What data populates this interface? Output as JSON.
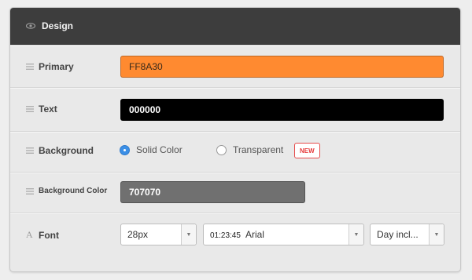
{
  "header": {
    "title": "Design",
    "icon": "eye-icon"
  },
  "primary": {
    "label": "Primary",
    "value": "FF8A30",
    "color": "#ff8a30"
  },
  "text": {
    "label": "Text",
    "value": "000000",
    "color": "#000000"
  },
  "background": {
    "label": "Background",
    "options": [
      {
        "label": "Solid Color",
        "selected": true
      },
      {
        "label": "Transparent",
        "selected": false
      }
    ],
    "badge": "NEW"
  },
  "background_color": {
    "label": "Background Color",
    "value": "707070",
    "color": "#707070"
  },
  "font": {
    "label": "Font",
    "icon_glyph": "A",
    "size": "28px",
    "time": "01:23:45",
    "family": "Arial",
    "day_option": "Day incl..."
  }
}
